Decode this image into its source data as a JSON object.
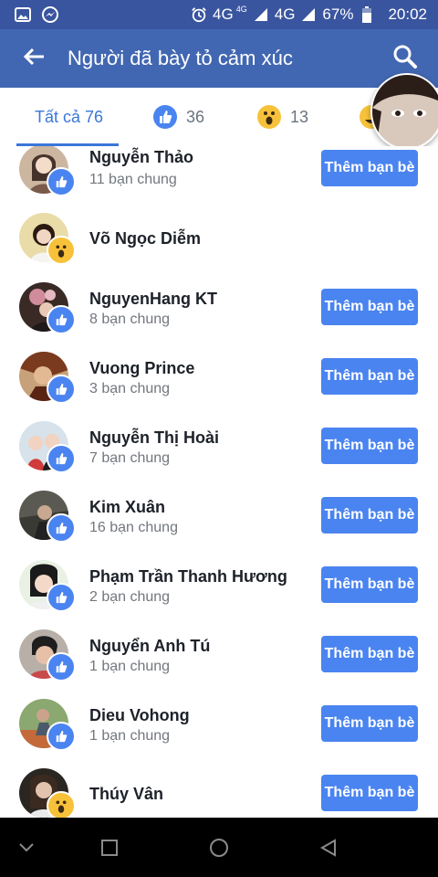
{
  "status_bar": {
    "network_1": "4G",
    "network_1_small": "4G",
    "network_2": "4G",
    "battery": "67%",
    "time": "20:02",
    "icons": [
      "image-icon",
      "messenger-icon",
      "alarm-icon",
      "signal-icon",
      "battery-icon"
    ]
  },
  "app_bar": {
    "title": "Người đã bày tỏ cảm xúc",
    "back_icon": "back-arrow-icon",
    "search_icon": "search-icon"
  },
  "tabs": [
    {
      "label": "Tất cả 76",
      "active": true
    },
    {
      "icon": "like-icon",
      "count": "36"
    },
    {
      "icon": "wow-icon",
      "count": "13"
    },
    {
      "icon": "haha-icon",
      "count": ""
    }
  ],
  "people": [
    {
      "name": "Nguyễn Thảo",
      "mutual": "11 bạn chung",
      "reaction": "like",
      "button": "Thêm bạn bè"
    },
    {
      "name": "Võ Ngọc Diễm",
      "mutual": "",
      "reaction": "wow",
      "button": ""
    },
    {
      "name": "NguyenHang KT",
      "mutual": "8 bạn chung",
      "reaction": "like",
      "button": "Thêm bạn bè"
    },
    {
      "name": "Vuong Prince",
      "mutual": "3 bạn chung",
      "reaction": "like",
      "button": "Thêm bạn bè"
    },
    {
      "name": "Nguyễn Thị Hoài",
      "mutual": "7 bạn chung",
      "reaction": "like",
      "button": "Thêm bạn bè"
    },
    {
      "name": "Kim Xuân",
      "mutual": "16 bạn chung",
      "reaction": "like",
      "button": "Thêm bạn bè"
    },
    {
      "name": "Phạm Trần Thanh Hương",
      "mutual": "2 bạn chung",
      "reaction": "like",
      "button": "Thêm bạn bè"
    },
    {
      "name": "Nguyển Anh Tú",
      "mutual": "1 bạn chung",
      "reaction": "like",
      "button": "Thêm bạn bè"
    },
    {
      "name": "Dieu Vohong",
      "mutual": "1 bạn chung",
      "reaction": "like",
      "button": "Thêm bạn bè"
    },
    {
      "name": "Thúy Vân",
      "mutual": "",
      "reaction": "wow",
      "button": "Thêm bạn bè"
    }
  ],
  "nav_bar": {
    "icons": [
      "collapse-icon",
      "recents-icon",
      "home-icon",
      "back-icon"
    ]
  },
  "colors": {
    "status_bar": "#3a559f",
    "app_bar": "#4267b2",
    "accent": "#3a77d9",
    "button": "#4a84f0"
  }
}
